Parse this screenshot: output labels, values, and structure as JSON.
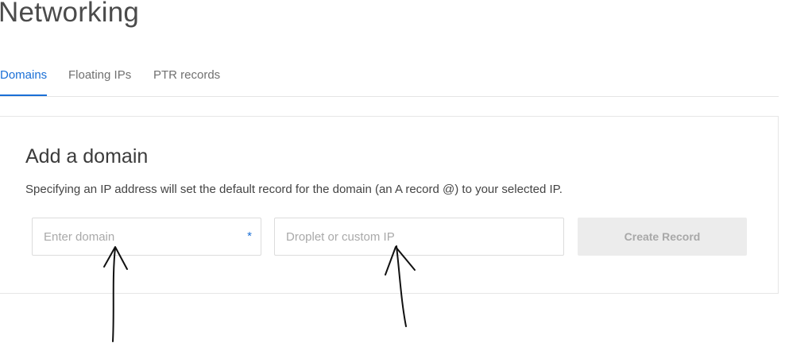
{
  "page": {
    "title": "Networking"
  },
  "tabs": [
    {
      "label": "Domains",
      "active": true
    },
    {
      "label": "Floating IPs",
      "active": false
    },
    {
      "label": "PTR records",
      "active": false
    }
  ],
  "add_domain": {
    "title": "Add a domain",
    "description": "Specifying an IP address will set the default record for the domain (an A record @) to your selected IP.",
    "domain_input": {
      "placeholder": "Enter domain",
      "value": "",
      "required_mark": "*"
    },
    "ip_input": {
      "placeholder": "Droplet or custom IP",
      "value": ""
    },
    "create_button_label": "Create Record"
  },
  "colors": {
    "accent": "#1a6fd6",
    "disabled_button_bg": "#ececec",
    "disabled_button_text": "#a8a8a8"
  },
  "annotations": {
    "icons": [
      "hand-drawn-arrow-icon",
      "hand-drawn-arrow-icon"
    ]
  }
}
